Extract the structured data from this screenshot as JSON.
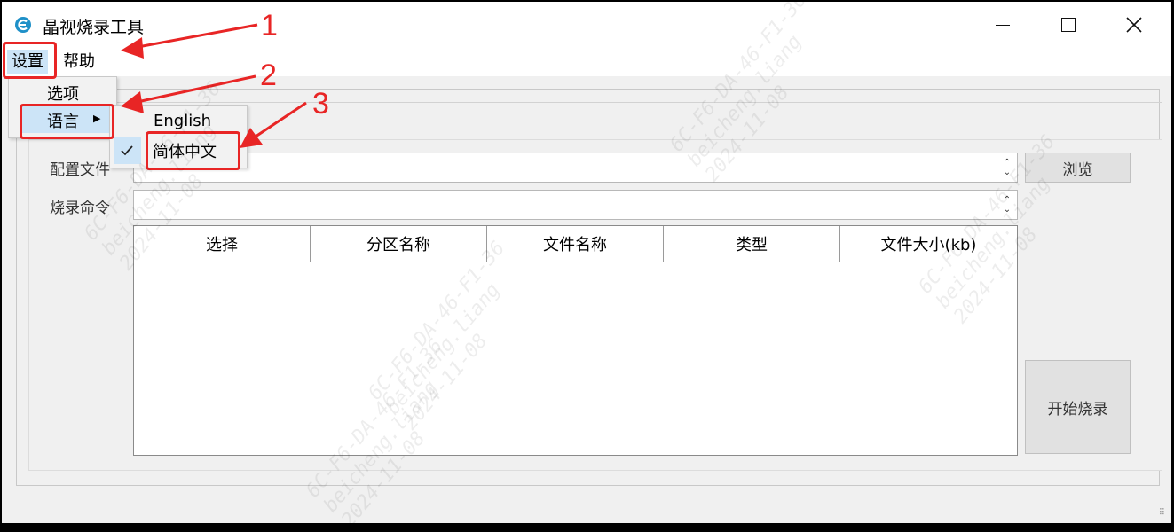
{
  "window": {
    "title": "晶视烧录工具"
  },
  "menubar": {
    "settings": "设置",
    "help": "帮助"
  },
  "settings_menu": {
    "options": "选项",
    "language": "语言"
  },
  "language_menu": {
    "english": "English",
    "chinese": "简体中文",
    "checked": "chinese"
  },
  "form": {
    "config_label": "配置文件",
    "config_value": "",
    "command_label": "烧录命令",
    "command_value": "",
    "browse_button": "浏览",
    "start_button": "开始烧录"
  },
  "table": {
    "columns": [
      "选择",
      "分区名称",
      "文件名称",
      "类型",
      "文件大小(kb)"
    ],
    "rows": []
  },
  "annotations": {
    "n1": "1",
    "n2": "2",
    "n3": "3"
  },
  "watermark": {
    "lines": [
      "6C-F6-DA-46-F1-36",
      "beicheng.liang",
      "2024-11-08"
    ]
  },
  "colors": {
    "accent": "#cce4f7",
    "annotation": "#e82525",
    "icon": "#1e90c8"
  }
}
